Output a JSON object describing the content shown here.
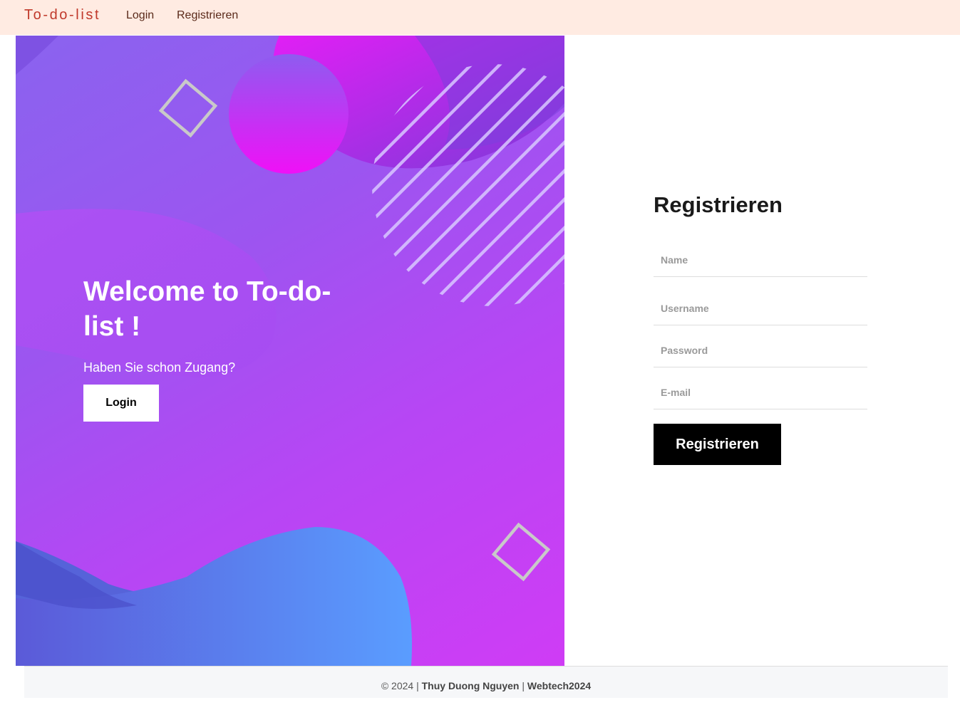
{
  "navbar": {
    "brand": "To-do-list",
    "links": [
      {
        "label": "Login"
      },
      {
        "label": "Registrieren"
      }
    ]
  },
  "hero": {
    "welcome_line1": "Welcome to To-do-",
    "welcome_line2": "list !",
    "subtitle": "Haben Sie schon Zugang?",
    "login_button": "Login"
  },
  "form": {
    "title": "Registrieren",
    "fields": [
      {
        "placeholder": "Name",
        "value": ""
      },
      {
        "placeholder": "Username",
        "value": ""
      },
      {
        "placeholder": "Password",
        "value": ""
      },
      {
        "placeholder": "E-mail",
        "value": ""
      }
    ],
    "submit_label": "Registrieren"
  },
  "footer": {
    "copyright": "© 2024 |",
    "author": "Thuy Duong Nguyen",
    "separator": "|",
    "project": "Webtech2024"
  },
  "colors": {
    "navbar_bg": "#ffebe2",
    "brand": "#c0392b",
    "hero_gradient_start": "#8a63ef",
    "hero_gradient_end": "#cf3cf5",
    "button_dark": "#000000",
    "footer_bg": "#f6f7f9"
  }
}
